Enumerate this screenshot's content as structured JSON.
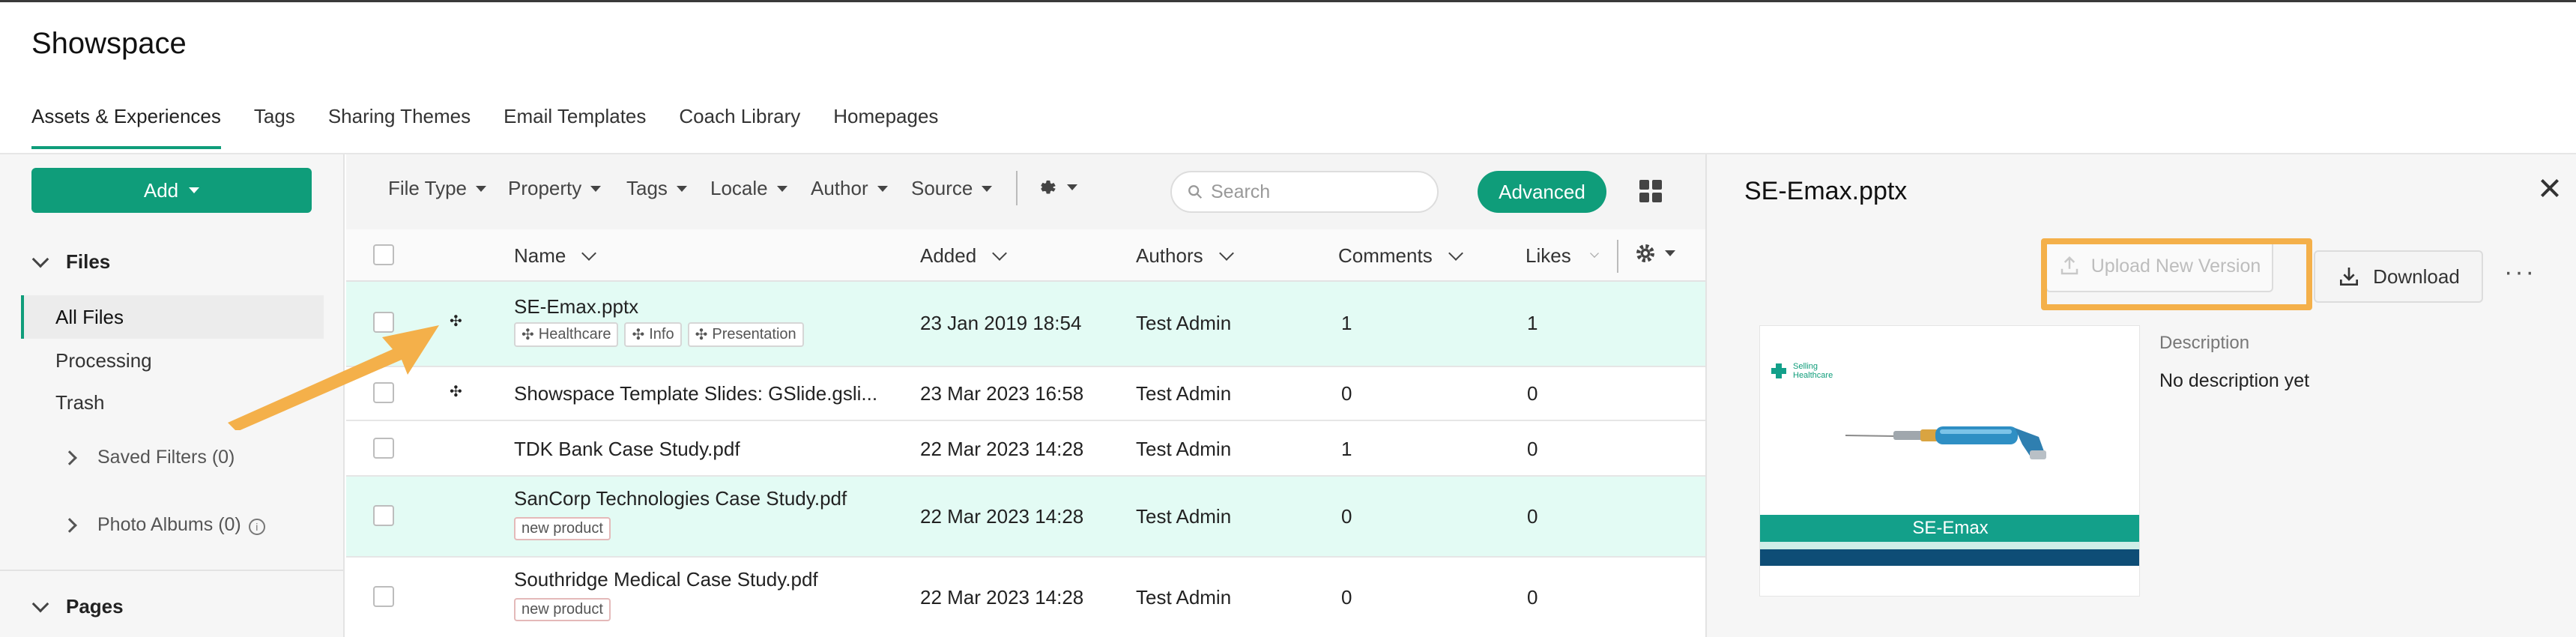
{
  "app": {
    "title": "Showspace"
  },
  "tabs": [
    {
      "label": "Assets & Experiences",
      "active": true
    },
    {
      "label": "Tags"
    },
    {
      "label": "Sharing Themes"
    },
    {
      "label": "Email Templates"
    },
    {
      "label": "Coach Library"
    },
    {
      "label": "Homepages"
    }
  ],
  "sidebar": {
    "add_label": "Add",
    "files_section": "Files",
    "items": [
      {
        "label": "All Files",
        "active": true
      },
      {
        "label": "Processing"
      },
      {
        "label": "Trash"
      }
    ],
    "saved_filters": "Saved Filters (0)",
    "photo_albums": "Photo Albums (0)",
    "pages_section": "Pages"
  },
  "filters": {
    "file_type": "File Type",
    "property": "Property",
    "tags": "Tags",
    "locale": "Locale",
    "author": "Author",
    "source": "Source",
    "search_placeholder": "Search",
    "advanced": "Advanced"
  },
  "table": {
    "columns": {
      "name": "Name",
      "added": "Added",
      "authors": "Authors",
      "comments": "Comments",
      "likes": "Likes"
    },
    "rows": [
      {
        "name": "SE-Emax.pptx",
        "tags": [
          "Healthcare",
          "Info",
          "Presentation"
        ],
        "added": "23 Jan 2019 18:54",
        "author": "Test Admin",
        "comments": "1",
        "likes": "1",
        "highlighted": true,
        "icon": "node-icon"
      },
      {
        "name": "Showspace Template Slides: GSlide.gsli...",
        "tags": [],
        "added": "23 Mar 2023 16:58",
        "author": "Test Admin",
        "comments": "0",
        "likes": "0",
        "highlighted": false,
        "icon": "node-icon"
      },
      {
        "name": "TDK Bank Case Study.pdf",
        "tags": [],
        "added": "22 Mar 2023 14:28",
        "author": "Test Admin",
        "comments": "1",
        "likes": "0",
        "highlighted": false
      },
      {
        "name": "SanCorp Technologies Case Study.pdf",
        "tags": [
          "new product"
        ],
        "added": "22 Mar 2023 14:28",
        "author": "Test Admin",
        "comments": "0",
        "likes": "0",
        "highlighted": true
      },
      {
        "name": "Southridge Medical Case Study.pdf",
        "tags": [
          "new product"
        ],
        "added": "22 Mar 2023 14:28",
        "author": "Test Admin",
        "comments": "0",
        "likes": "0",
        "highlighted": false
      }
    ]
  },
  "panel": {
    "title": "SE-Emax.pptx",
    "upload_label": "Upload New Version",
    "download_label": "Download",
    "more_label": "···",
    "thumbnail": {
      "logo_line1": "Selling",
      "logo_line2": "Healthcare",
      "band_text": "SE-Emax"
    },
    "description_label": "Description",
    "description_value": "No description yet"
  },
  "colors": {
    "accent": "#0f9d7a",
    "highlight": "#f4b04a",
    "row_highlight": "#e3fbf4"
  }
}
